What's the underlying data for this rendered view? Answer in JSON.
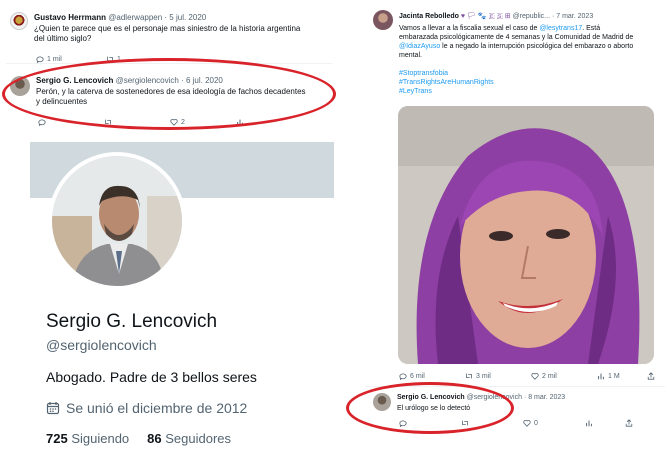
{
  "tweet1": {
    "name": "Gustavo Herrmann",
    "handle": "@adlerwappen · 5 jul. 2020",
    "text_line1": "¿Quien te parece que es el personaje mas siniestro de la historia argentina",
    "text_line2": "del último siglo?",
    "replies": "1 mil",
    "retweets": "1",
    "likes": "",
    "views": ""
  },
  "tweet2": {
    "name": "Sergio G. Lencovich",
    "handle": "@sergiolencovich · 6 jul. 2020",
    "text_line1": "Perón, y la caterva de sostenedores de esa ideología de fachos decadentes",
    "text_line2": "y delincuentes",
    "likes": "2"
  },
  "profile": {
    "name": "Sergio G. Lencovich",
    "handle": "@sergiolencovich",
    "bio": "Abogado. Padre de 3 bellos seres",
    "joined": "Se unió el diciembre de 2012",
    "following_count": "725",
    "following_label": "Siguiendo",
    "followers_count": "86",
    "followers_label": "Seguidores"
  },
  "tweet3": {
    "name": "Jacinta Rebolledo",
    "emoji": "♥ 🏳 🐾 🇪 🇸 ⊞",
    "handle": "@republic... · 7 mar. 2023",
    "text_line1a": "Vamos a llevar a la fiscalia sexual el caso de ",
    "mention1": "@lesytrans17",
    "text_line1b": ". Está",
    "text_line2": "embarazada psicológicamente de 4 semanas y la Comunidad de Madrid de",
    "mention2": "@IdiazAyuso",
    "text_line3b": " le a negado la interrupción psicológica del embarazo o aborto",
    "text_line4": "mental.",
    "hashtags": [
      "#Stoptransfobia",
      "#TransRightsAreHumanRights",
      "#LeyTrans"
    ],
    "replies": "6 mil",
    "retweets": "3 mil",
    "likes": "2 mil",
    "views": "1 M"
  },
  "tweet4": {
    "name": "Sergio G. Lencovich",
    "handle": "@sergiolencovich · 8 mar. 2023",
    "text": "El urólogo se lo detectó",
    "likes": "0"
  },
  "colors": {
    "accent": "#1d9bf0",
    "highlight": "#d9232a",
    "banner": "#cfd9de"
  }
}
